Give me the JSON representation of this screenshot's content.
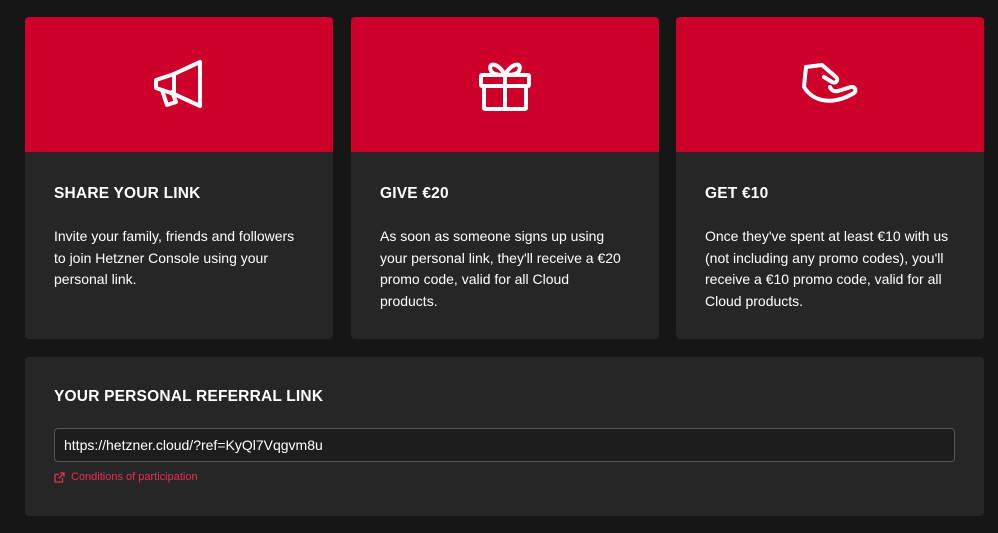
{
  "cards": [
    {
      "icon": "megaphone-icon",
      "title": "SHARE YOUR LINK",
      "text": "Invite your family, friends and followers to join Hetzner Console using your personal link."
    },
    {
      "icon": "gift-icon",
      "title": "GIVE €20",
      "text": "As soon as someone signs up using your personal link, they'll receive a €20 promo code, valid for all Cloud products."
    },
    {
      "icon": "receiving-hand-icon",
      "title": "GET €10",
      "text": "Once they've spent at least €10 with us (not including any promo codes), you'll receive a €10 promo code, valid for all Cloud products."
    }
  ],
  "referral": {
    "title": "YOUR PERSONAL REFERRAL LINK",
    "link_value": "https://hetzner.cloud/?ref=KyQl7Vqgvm8u",
    "conditions_label": "Conditions of participation",
    "conditions_icon": "external-link-icon"
  },
  "colors": {
    "background": "#161616",
    "card": "#262626",
    "accent": "#cc0029",
    "link": "#e8304f",
    "text": "#ffffff"
  }
}
